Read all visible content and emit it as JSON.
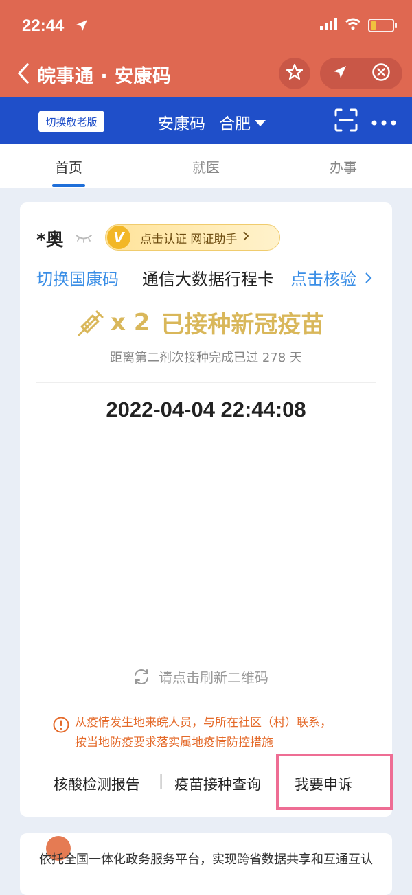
{
  "status_bar": {
    "time": "22:44"
  },
  "title_bar": {
    "title": "皖事通 · 安康码"
  },
  "blue_bar": {
    "elder_mode": "切换敬老版",
    "title": "安康码",
    "city": "合肥"
  },
  "tabs": [
    {
      "label": "首页"
    },
    {
      "label": "就医"
    },
    {
      "label": "办事"
    }
  ],
  "card": {
    "name": "*奥",
    "auth_v": "V",
    "auth_label": "点击认证 网证助手",
    "switch_link": "切换国康码",
    "trip_label": "通信大数据行程卡",
    "verify_link": "点击核验",
    "vaccine_count": "x 2",
    "vaccine_status": "已接种新冠疫苗",
    "days_text": "距离第二剂次接种完成已过 278 天",
    "datetime": "2022-04-04 22:44:08",
    "refresh_label": "请点击刷新二维码",
    "notice_line1": "从疫情发生地来皖人员，与所在社区（村）联系，",
    "notice_line2": "按当地防疫要求落实属地疫情防控措施",
    "link_nucleic": "核酸检测报告",
    "link_separator": "|",
    "link_vaccine": "疫苗接种查询",
    "link_appeal": "我要申诉"
  },
  "footer": {
    "text": "依托全国一体化政务服务平台，实现跨省数据共享和互通互认"
  },
  "colors": {
    "header": "#df6851",
    "blue": "#1f4fc9",
    "link": "#3a8ee6",
    "gold": "#d9b75a",
    "warning": "#e46a2a",
    "highlight": "#ee6d94"
  }
}
